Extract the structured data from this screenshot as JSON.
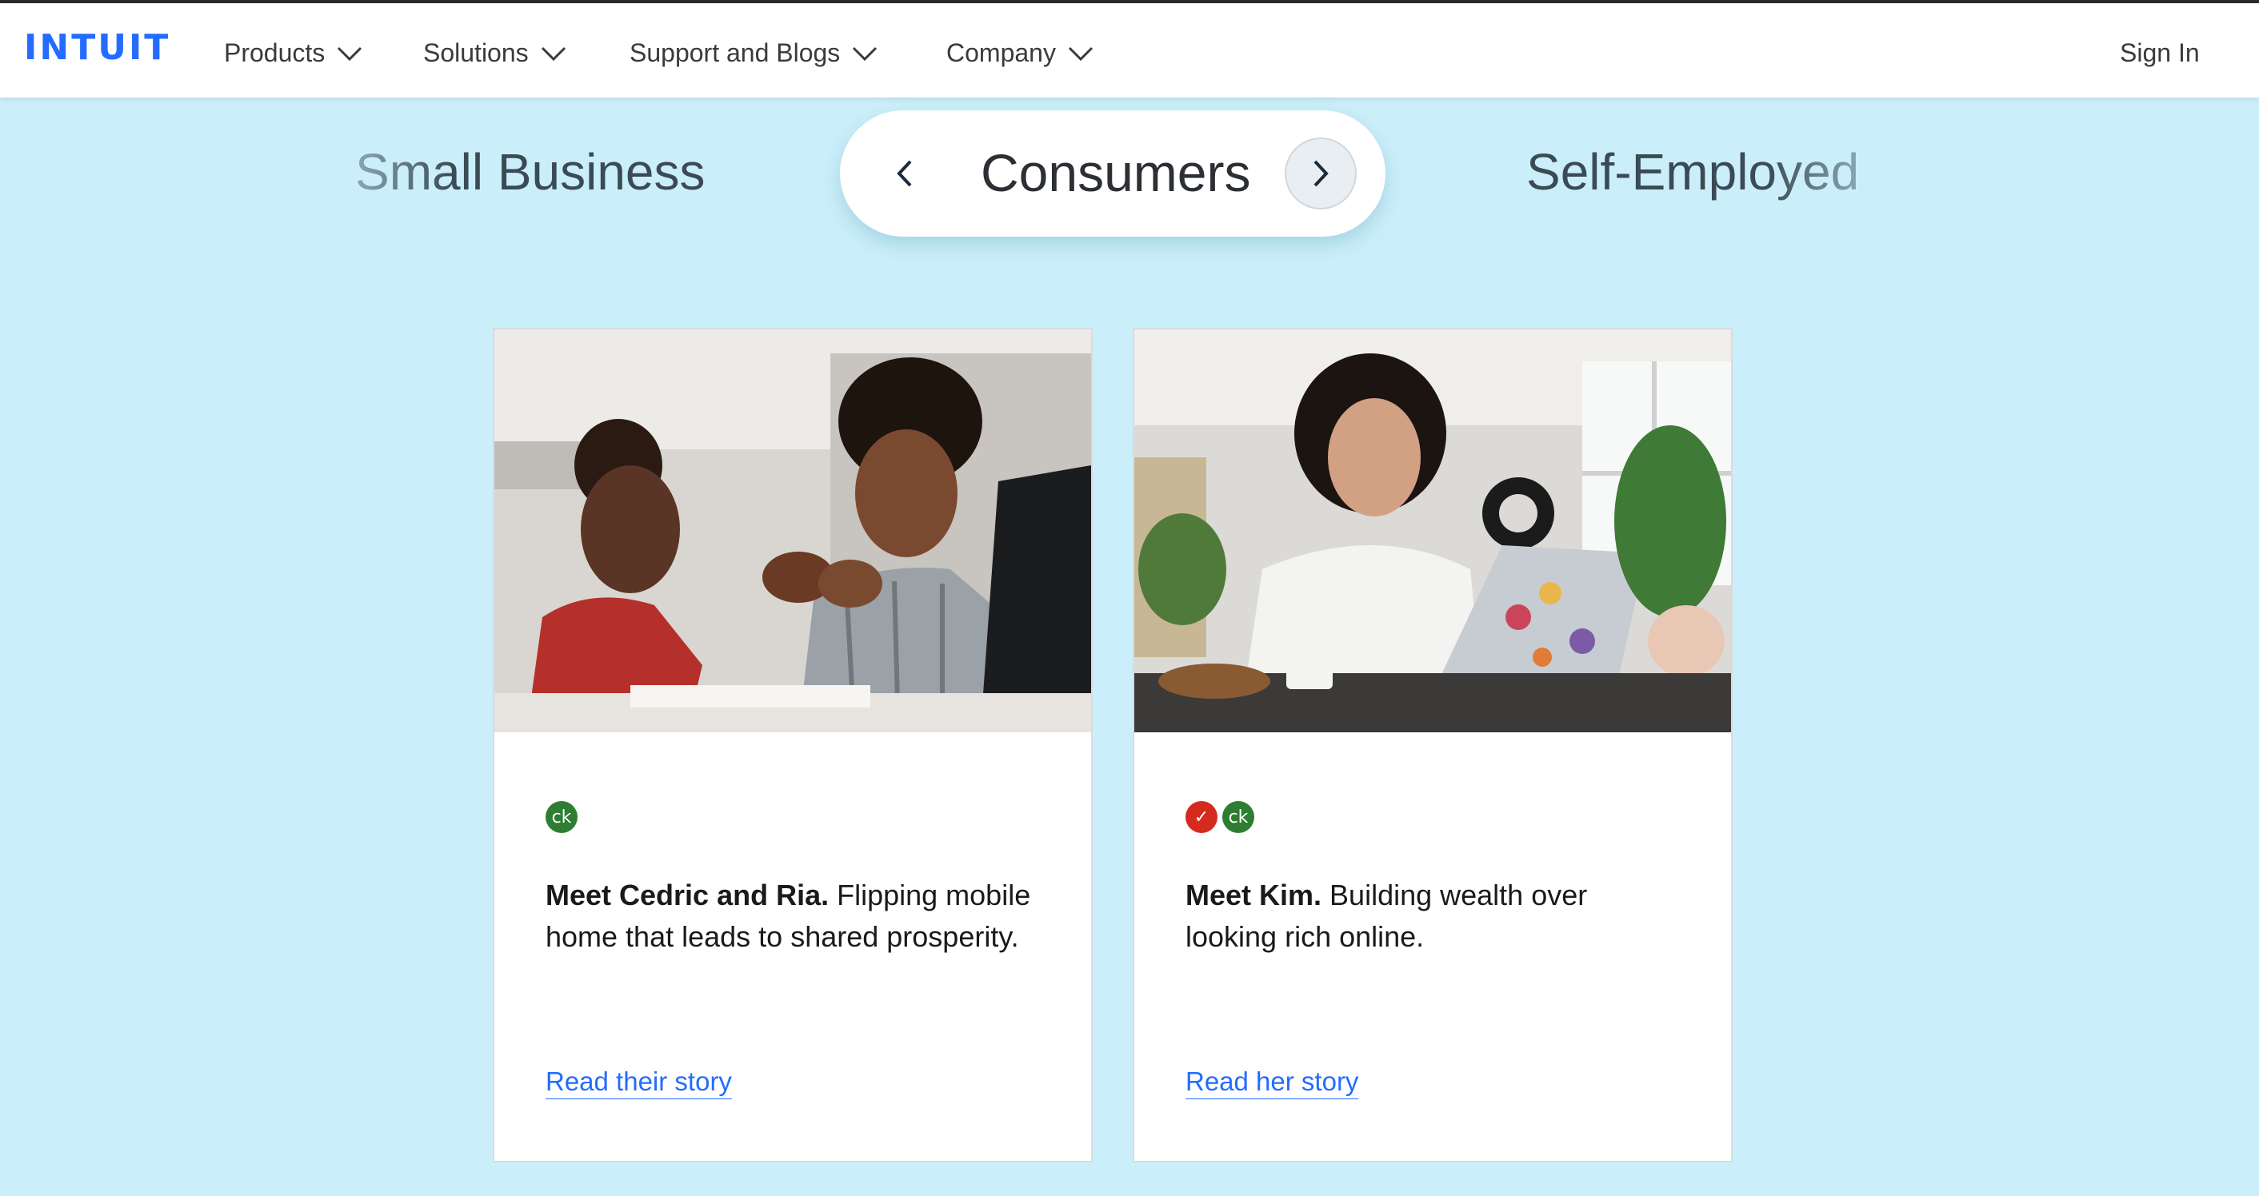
{
  "header": {
    "logo": "INTUIT",
    "nav": [
      {
        "label": "Products"
      },
      {
        "label": "Solutions"
      },
      {
        "label": "Support and Blogs"
      },
      {
        "label": "Company"
      }
    ],
    "sign_in": "Sign In"
  },
  "segments": {
    "left": "Small Business",
    "current": "Consumers",
    "right": "Self-Employed"
  },
  "cards": [
    {
      "brands": [
        "ck"
      ],
      "title": "Meet Cedric and Ria.",
      "text": " Flipping mobile home that leads to shared prosperity.",
      "link": "Read their story"
    },
    {
      "brands": [
        "✓",
        "ck"
      ],
      "title": "Meet Kim.",
      "text": " Building wealth over looking rich online.",
      "link": "Read her story"
    }
  ],
  "colors": {
    "page_background": "#cbeffa",
    "brand_blue": "#236cff",
    "creditkarma_green": "#2e7d32",
    "turbotax_red": "#d52b1e"
  }
}
